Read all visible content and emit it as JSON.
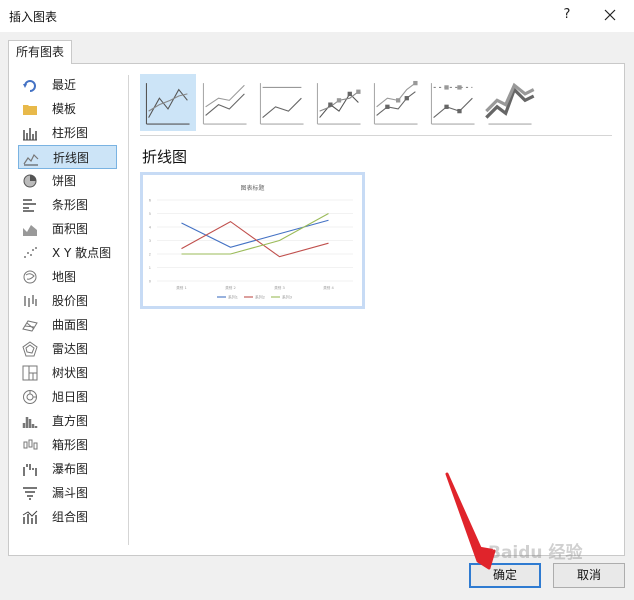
{
  "window": {
    "title": "插入图表",
    "help_label": "?"
  },
  "tab": {
    "label": "所有图表"
  },
  "sidebar": {
    "items": [
      {
        "label": "最近",
        "icon": "recent-icon"
      },
      {
        "label": "模板",
        "icon": "folder-icon"
      },
      {
        "label": "柱形图",
        "icon": "column-chart-icon"
      },
      {
        "label": "折线图",
        "icon": "line-chart-icon",
        "selected": true
      },
      {
        "label": "饼图",
        "icon": "pie-chart-icon"
      },
      {
        "label": "条形图",
        "icon": "bar-chart-icon"
      },
      {
        "label": "面积图",
        "icon": "area-chart-icon"
      },
      {
        "label": "X Y 散点图",
        "icon": "scatter-chart-icon"
      },
      {
        "label": "地图",
        "icon": "map-chart-icon"
      },
      {
        "label": "股价图",
        "icon": "stock-chart-icon"
      },
      {
        "label": "曲面图",
        "icon": "surface-chart-icon"
      },
      {
        "label": "雷达图",
        "icon": "radar-chart-icon"
      },
      {
        "label": "树状图",
        "icon": "treemap-chart-icon"
      },
      {
        "label": "旭日图",
        "icon": "sunburst-chart-icon"
      },
      {
        "label": "直方图",
        "icon": "histogram-chart-icon"
      },
      {
        "label": "箱形图",
        "icon": "box-whisker-chart-icon"
      },
      {
        "label": "瀑布图",
        "icon": "waterfall-chart-icon"
      },
      {
        "label": "漏斗图",
        "icon": "funnel-chart-icon"
      },
      {
        "label": "组合图",
        "icon": "combo-chart-icon"
      }
    ]
  },
  "subtypes": [
    {
      "icon": "line-icon",
      "selected": true
    },
    {
      "icon": "stacked-line-icon"
    },
    {
      "icon": "percent-stacked-line-icon"
    },
    {
      "icon": "line-with-markers-icon"
    },
    {
      "icon": "stacked-line-with-markers-icon"
    },
    {
      "icon": "percent-stacked-line-with-markers-icon"
    },
    {
      "icon": "3d-line-icon"
    }
  ],
  "main": {
    "heading": "折线图"
  },
  "preview": {
    "chart_title": "图表标题",
    "categories": [
      "类别 1",
      "类别 2",
      "类别 3",
      "类别 4"
    ],
    "y_ticks": [
      "0",
      "1",
      "2",
      "3",
      "4",
      "5",
      "6"
    ],
    "series": [
      {
        "name": "系列1",
        "values": [
          4.3,
          2.5,
          3.5,
          4.5
        ],
        "color": "#4472c4"
      },
      {
        "name": "系列2",
        "values": [
          2.4,
          4.4,
          1.8,
          2.8
        ],
        "color": "#c0504d"
      },
      {
        "name": "系列3",
        "values": [
          2,
          2,
          3,
          5
        ],
        "color": "#9bbb59"
      }
    ]
  },
  "buttons": {
    "ok": "确定",
    "cancel": "取消"
  },
  "watermark": "Baidu 经验",
  "colors": {
    "selection": "#cce4f7",
    "selection_border": "#7ab3e2",
    "annotation_arrow": "#e0242b",
    "ok_border": "#2f7bd1"
  }
}
